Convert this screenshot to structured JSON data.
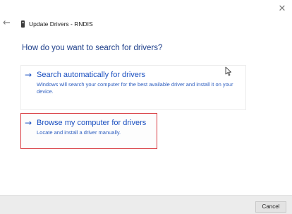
{
  "window": {
    "close_glyph": "✕",
    "back_glyph": "←",
    "title": "Update Drivers - RNDIS"
  },
  "main": {
    "question": "How do you want to search for drivers?",
    "options": [
      {
        "arrow_glyph": "→",
        "title": "Search automatically for drivers",
        "description": "Windows will search your computer for the best available driver and install it on your device."
      },
      {
        "arrow_glyph": "→",
        "title": "Browse my computer for drivers",
        "description": "Locate and install a driver manually."
      }
    ]
  },
  "footer": {
    "cancel_label": "Cancel"
  },
  "colors": {
    "accent": "#1a4fc0",
    "question": "#1e3f8a",
    "highlight_border": "#d8393f"
  },
  "icons": {
    "close": "close-icon",
    "back": "back-arrow-icon",
    "device": "network-device-icon",
    "arrow": "arrow-right-icon",
    "cursor": "mouse-cursor-icon"
  }
}
